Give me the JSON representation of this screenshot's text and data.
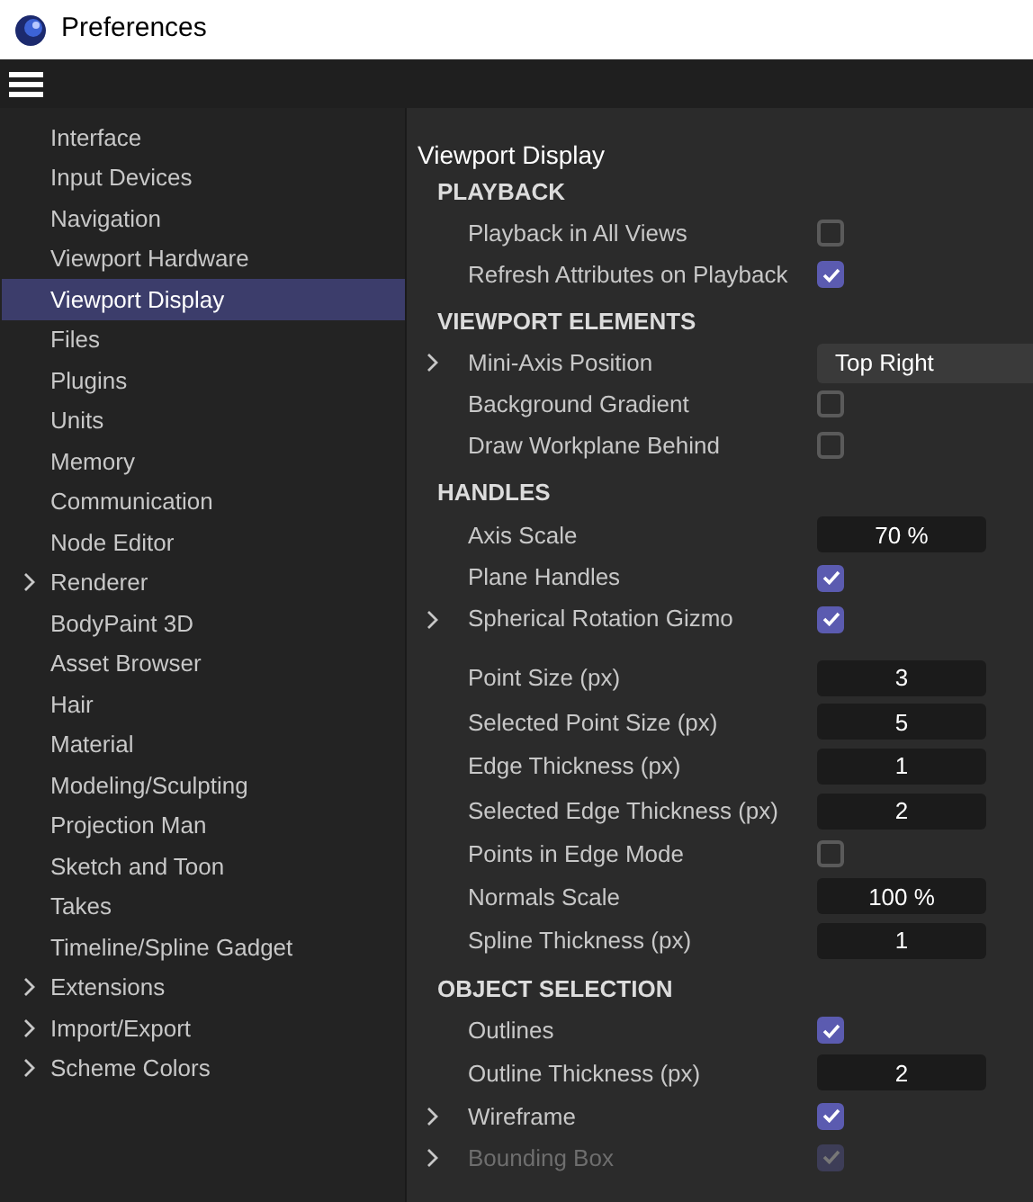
{
  "window": {
    "title": "Preferences"
  },
  "sidebar": {
    "items": [
      {
        "label": "Interface",
        "selected": false
      },
      {
        "label": "Input Devices",
        "selected": false
      },
      {
        "label": "Navigation",
        "selected": false
      },
      {
        "label": "Viewport Hardware",
        "selected": false
      },
      {
        "label": "Viewport Display",
        "selected": true
      },
      {
        "label": "Files",
        "selected": false
      },
      {
        "label": "Plugins",
        "selected": false
      },
      {
        "label": "Units",
        "selected": false
      },
      {
        "label": "Memory",
        "selected": false
      },
      {
        "label": "Communication",
        "selected": false
      },
      {
        "label": "Node Editor",
        "selected": false
      },
      {
        "label": "Renderer",
        "selected": false,
        "expandable": true
      },
      {
        "label": "BodyPaint 3D",
        "selected": false
      },
      {
        "label": "Asset Browser",
        "selected": false
      },
      {
        "label": "Hair",
        "selected": false
      },
      {
        "label": "Material",
        "selected": false
      },
      {
        "label": "Modeling/Sculpting",
        "selected": false
      },
      {
        "label": "Projection Man",
        "selected": false
      },
      {
        "label": "Sketch and Toon",
        "selected": false
      },
      {
        "label": "Takes",
        "selected": false
      },
      {
        "label": "Timeline/Spline Gadget",
        "selected": false
      },
      {
        "label": "Extensions",
        "selected": false,
        "expandable": true
      },
      {
        "label": "Import/Export",
        "selected": false,
        "expandable": true
      },
      {
        "label": "Scheme Colors",
        "selected": false,
        "expandable": true
      }
    ]
  },
  "panel": {
    "title": "Viewport Display",
    "sections": [
      {
        "title": "PLAYBACK",
        "groups": [
          [
            {
              "kind": "checkbox",
              "label": "Playback in All Views",
              "checked": false
            },
            {
              "kind": "checkbox",
              "label": "Refresh Attributes on Playback",
              "checked": true
            }
          ]
        ]
      },
      {
        "title": "VIEWPORT ELEMENTS",
        "groups": [
          [
            {
              "kind": "dropdown",
              "label": "Mini-Axis Position",
              "value": "Top Right",
              "expandable": true
            },
            {
              "kind": "checkbox",
              "label": "Background Gradient",
              "checked": false
            },
            {
              "kind": "checkbox",
              "label": "Draw Workplane Behind",
              "checked": false
            }
          ]
        ]
      },
      {
        "title": "HANDLES",
        "groups": [
          [
            {
              "kind": "number",
              "label": "Axis Scale",
              "value": "70 %"
            },
            {
              "kind": "checkbox",
              "label": "Plane Handles",
              "checked": true
            },
            {
              "kind": "checkbox",
              "label": "Spherical Rotation Gizmo",
              "checked": true,
              "expandable": true
            }
          ],
          [
            {
              "kind": "number",
              "label": "Point Size (px)",
              "value": "3"
            },
            {
              "kind": "number",
              "label": "Selected Point Size (px)",
              "value": "5"
            },
            {
              "kind": "number",
              "label": "Edge Thickness (px)",
              "value": "1"
            },
            {
              "kind": "number",
              "label": "Selected Edge Thickness (px)",
              "value": "2"
            },
            {
              "kind": "checkbox",
              "label": "Points in Edge Mode",
              "checked": false
            },
            {
              "kind": "number",
              "label": "Normals Scale",
              "value": "100 %"
            },
            {
              "kind": "number",
              "label": "Spline Thickness (px)",
              "value": "1"
            }
          ]
        ]
      },
      {
        "title": "OBJECT SELECTION",
        "groups": [
          [
            {
              "kind": "checkbox",
              "label": "Outlines",
              "checked": true
            },
            {
              "kind": "number",
              "label": "Outline Thickness (px)",
              "value": "2"
            },
            {
              "kind": "checkbox",
              "label": "Wireframe",
              "checked": true,
              "expandable": true
            },
            {
              "kind": "checkbox",
              "label": "Bounding Box",
              "checked": true,
              "expandable": true,
              "disabled": true
            }
          ]
        ]
      }
    ]
  }
}
